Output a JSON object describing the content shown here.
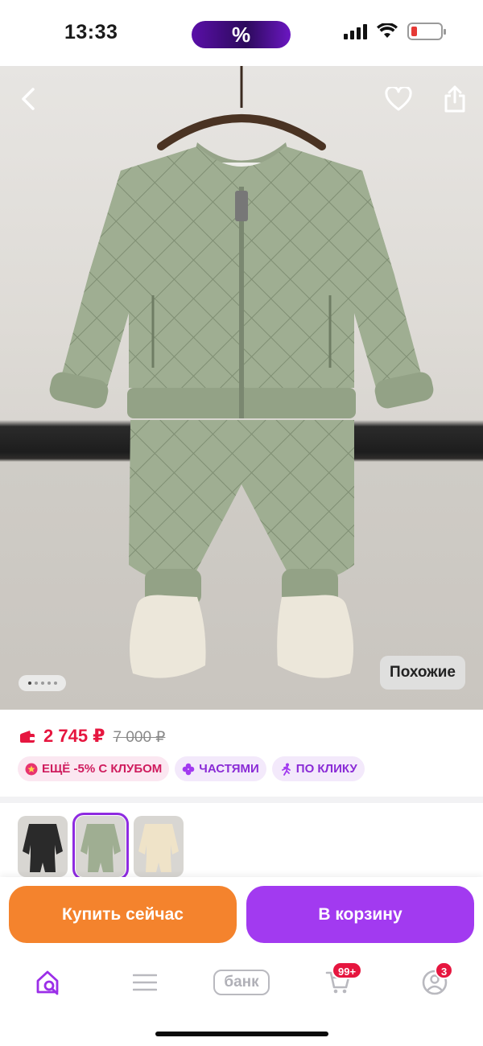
{
  "status_bar": {
    "time": "13:33",
    "center_pill": "%",
    "battery_level": 0.2,
    "battery_color": "#e53935"
  },
  "hero": {
    "back_icon": "chevron-left-icon",
    "favorite_icon": "heart-icon",
    "share_icon": "share-icon",
    "similar_label": "Похожие",
    "image_count": 5,
    "active_image_index": 0
  },
  "price": {
    "current": "2 745 ₽",
    "old": "7 000 ₽",
    "wallet_icon": "wallet-icon",
    "accent_color": "#e6163f"
  },
  "badges": [
    {
      "icon": "club-icon",
      "label": "ЕЩЁ -5% С КЛУБОМ"
    },
    {
      "icon": "parts-icon",
      "label": "ЧАСТЯМИ"
    },
    {
      "icon": "run-icon",
      "label": "ПО КЛИКУ"
    }
  ],
  "variants": [
    {
      "color": "black",
      "selected": false
    },
    {
      "color": "sage-green",
      "selected": true
    },
    {
      "color": "cream",
      "selected": false
    }
  ],
  "actions": {
    "buy_now": "Купить сейчас",
    "add_to_cart": "В корзину",
    "buy_color": "#f4832d",
    "cart_color": "#a23af0"
  },
  "tabbar": {
    "home_icon": "home-search-icon",
    "catalog_icon": "menu-icon",
    "bank_label": "банк",
    "cart_icon": "cart-icon",
    "cart_badge": "99+",
    "profile_icon": "profile-icon",
    "profile_badge": "3"
  }
}
